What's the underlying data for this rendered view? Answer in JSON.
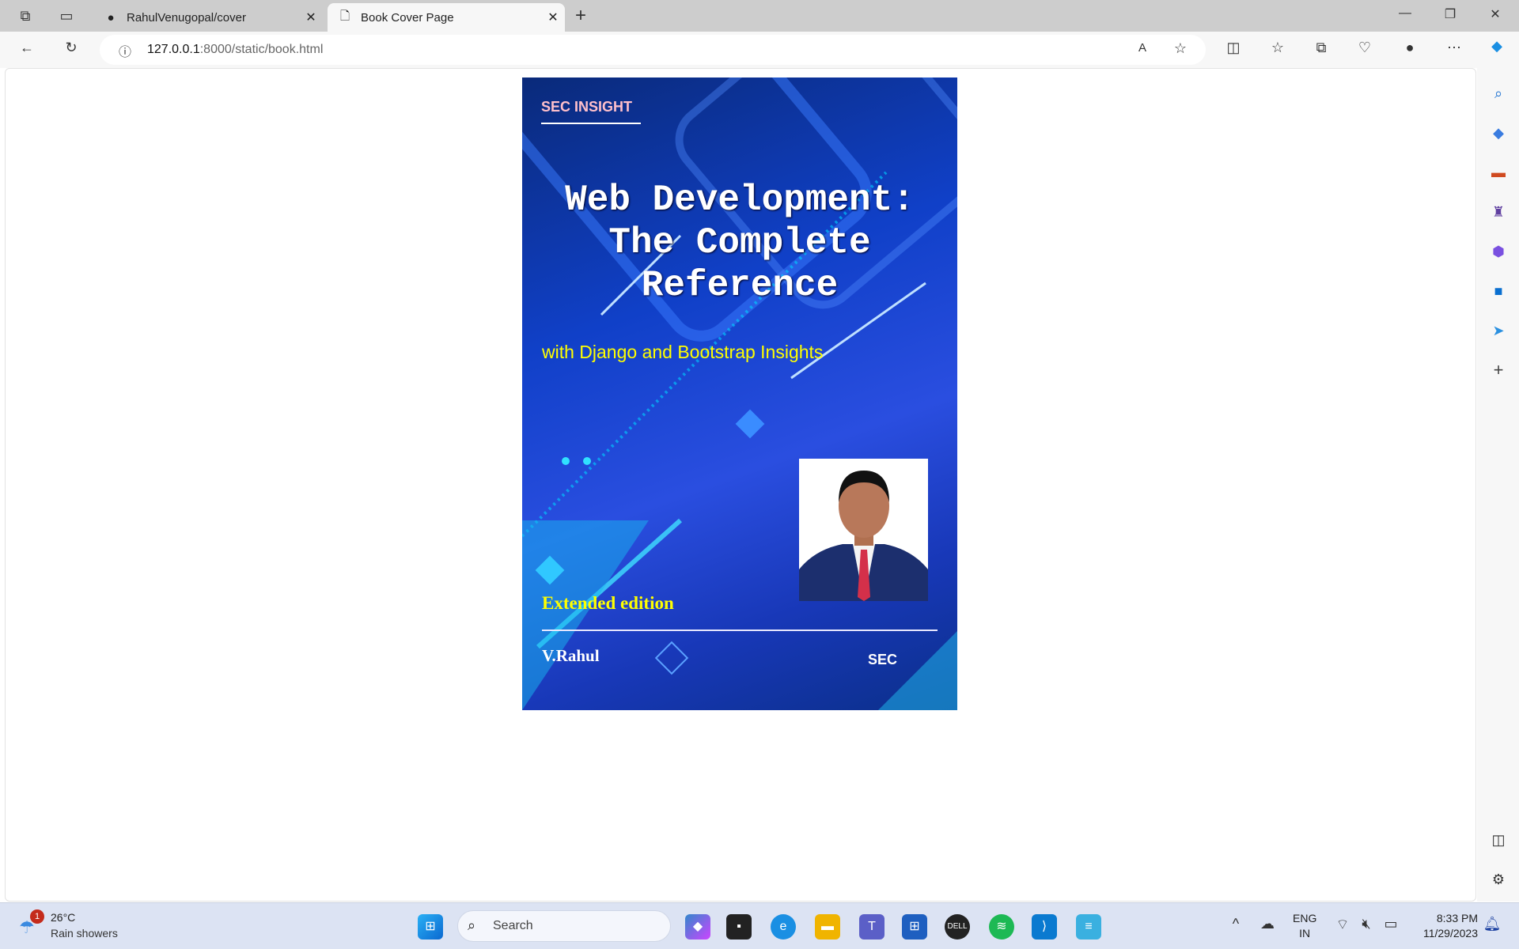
{
  "browser": {
    "tabs": [
      {
        "title": "RahulVenugopal/cover",
        "icon": "github-icon"
      },
      {
        "title": "Book Cover Page",
        "icon": "page-icon",
        "active": true
      }
    ],
    "url_host": "127.0.0.1",
    "url_rest": ":8000/static/book.html"
  },
  "cover": {
    "brand": "SEC INSIGHT",
    "title_lines": [
      "Web Development:",
      "The Complete",
      "Reference"
    ],
    "subtitle": "with Django and Bootstrap Insights",
    "edition": "Extended edition",
    "author": "V.Rahul",
    "publisher": "SEC"
  },
  "taskbar": {
    "weather_badge": "1",
    "temperature": "26°C",
    "weather": "Rain showers",
    "search_placeholder": "Search",
    "lang1": "ENG",
    "lang2": "IN",
    "time": "8:33 PM",
    "date": "11/29/2023"
  }
}
